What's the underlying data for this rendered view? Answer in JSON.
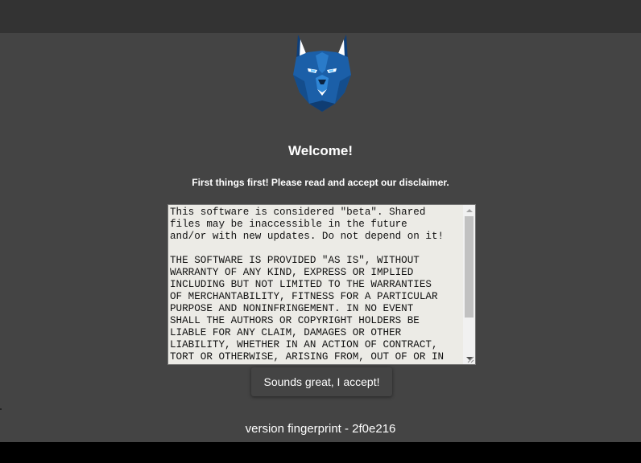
{
  "colors": {
    "topbar": "#333333",
    "panel": "#444444",
    "footer": "#000000",
    "text": "#ffffff",
    "textarea_bg": "#ecebe6",
    "logo_blue": "#1b5fa8"
  },
  "logo": {
    "icon": "wolf-logo-icon"
  },
  "welcome": {
    "title": "Welcome!",
    "subtitle": "First things first! Please read and accept our disclaimer."
  },
  "disclaimer": {
    "text": "This software is considered \"beta\". Shared\nfiles may be inaccessible in the future\nand/or with new updates. Do not depend on it!\n\nTHE SOFTWARE IS PROVIDED \"AS IS\", WITHOUT\nWARRANTY OF ANY KIND, EXPRESS OR IMPLIED\nINCLUDING BUT NOT LIMITED TO THE WARRANTIES\nOF MERCHANTABILITY, FITNESS FOR A PARTICULAR\nPURPOSE AND NONINFRINGEMENT. IN NO EVENT\nSHALL THE AUTHORS OR COPYRIGHT HOLDERS BE\nLIABLE FOR ANY CLAIM, DAMAGES OR OTHER\nLIABILITY, WHETHER IN AN ACTION OF CONTRACT,\nTORT OR OTHERWISE, ARISING FROM, OUT OF OR IN\nCONNECTION WITH THE SOFTWARE OR THE USE OR"
  },
  "actions": {
    "accept_label": "Sounds great, I accept!"
  },
  "footer": {
    "version_label": "version fingerprint - 2f0e216"
  }
}
